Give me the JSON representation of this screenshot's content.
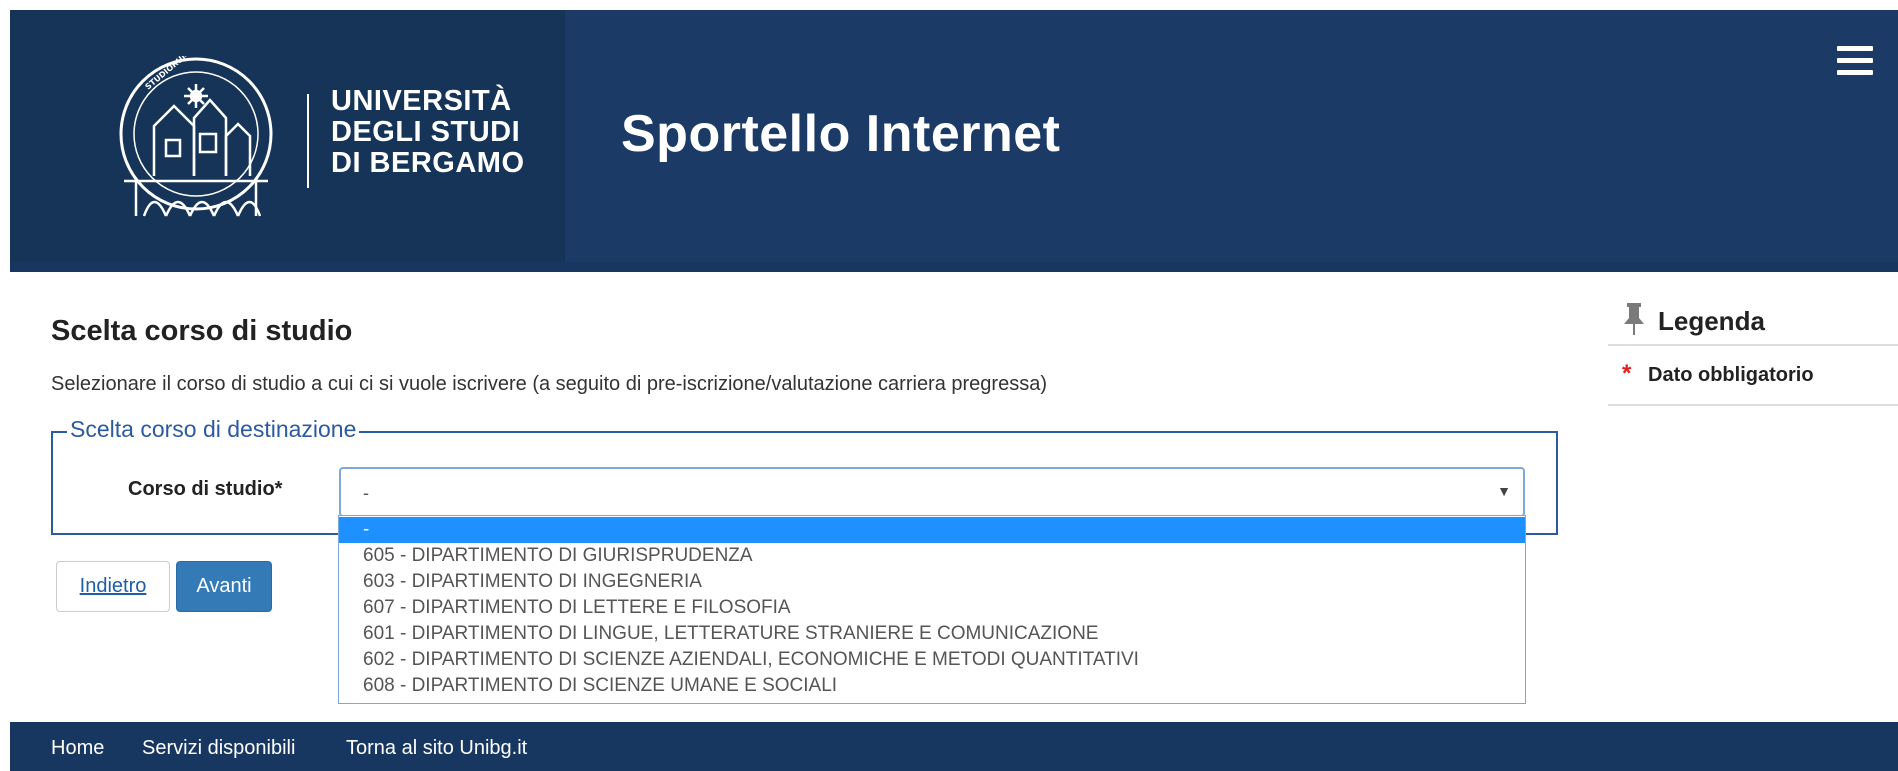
{
  "header": {
    "logo_lines": [
      "UNIVERSITÀ",
      "DEGLI STUDI",
      "DI BERGAMO"
    ],
    "crest_text": "UNIVERSITAS STUDIORUM BERGOMENSIS",
    "site_title": "Sportello Internet",
    "menu_icon": "hamburger-menu-icon"
  },
  "main": {
    "page_title": "Scelta corso di studio",
    "intro": "Selezionare il corso di studio a cui ci si vuole iscrivere (a seguito di pre-iscrizione/valutazione carriera pregressa)",
    "fieldset_legend": "Scelta corso di destinazione",
    "field_label": "Corso di studio*",
    "select": {
      "value": "-",
      "options": [
        "-",
        "605 - DIPARTIMENTO DI GIURISPRUDENZA",
        "603 - DIPARTIMENTO DI INGEGNERIA",
        "607 - DIPARTIMENTO DI LETTERE E FILOSOFIA",
        "601 - DIPARTIMENTO DI LINGUE, LETTERATURE STRANIERE E COMUNICAZIONE",
        "602 - DIPARTIMENTO DI SCIENZE AZIENDALI, ECONOMICHE E METODI QUANTITATIVI",
        "608 - DIPARTIMENTO DI SCIENZE UMANE E SOCIALI"
      ],
      "highlighted_option": 0
    },
    "back_label": "Indietro",
    "next_label": "Avanti"
  },
  "sidebar": {
    "legend_title": "Legenda",
    "legend_icon": "pin-icon",
    "required_marker": "*",
    "required_label": "Dato obbligatorio"
  },
  "footer": {
    "links": [
      "Home",
      "Servizi disponibili",
      "Torna al sito Unibg.it"
    ]
  },
  "colors": {
    "header_bg": "#173761",
    "accent_blue": "#337ab7",
    "highlight": "#1e90ff",
    "required_star": "#e02020"
  }
}
